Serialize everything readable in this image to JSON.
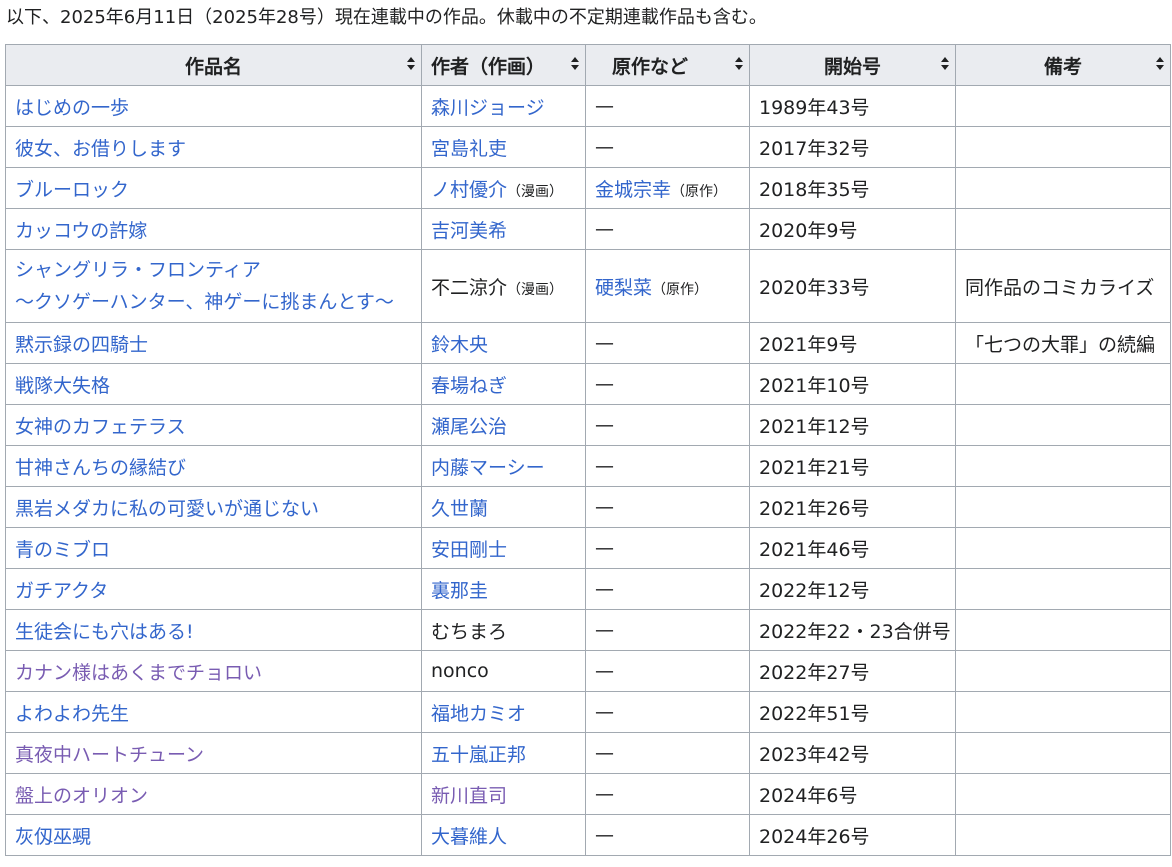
{
  "intro": "以下、2025年6月11日（2025年28号）現在連載中の作品。休載中の不定期連載作品も含む。",
  "headers": {
    "title": "作品名",
    "author": "作者（作画）",
    "original": "原作など",
    "start": "開始号",
    "notes": "備考"
  },
  "rows": [
    {
      "title": "はじめの一歩",
      "author": "森川ジョージ",
      "original": "—",
      "start": "1989年43号",
      "notes": ""
    },
    {
      "title": "彼女、お借りします",
      "author": "宮島礼吏",
      "original": "—",
      "start": "2017年32号",
      "notes": ""
    },
    {
      "title": "ブルーロック",
      "author": "ノ村優介",
      "author_note": "（漫画）",
      "original": "金城宗幸",
      "original_note": "（原作）",
      "start": "2018年35号",
      "notes": ""
    },
    {
      "title": "カッコウの許嫁",
      "author": "吉河美希",
      "original": "—",
      "start": "2020年9号",
      "notes": ""
    },
    {
      "title": "シャングリラ・フロンティア",
      "title2": "〜クソゲーハンター、神ゲーに挑まんとす〜",
      "author": "不二涼介",
      "author_note": "（漫画）",
      "original": "硬梨菜",
      "original_note": "（原作）",
      "start": "2020年33号",
      "notes": "同作品のコミカライズ"
    },
    {
      "title": "黙示録の四騎士",
      "author": "鈴木央",
      "original": "—",
      "start": "2021年9号",
      "notes": "「七つの大罪」の続編"
    },
    {
      "title": "戦隊大失格",
      "author": "春場ねぎ",
      "original": "—",
      "start": "2021年10号",
      "notes": ""
    },
    {
      "title": "女神のカフェテラス",
      "author": "瀬尾公治",
      "original": "—",
      "start": "2021年12号",
      "notes": ""
    },
    {
      "title": "甘神さんちの縁結び",
      "author": "内藤マーシー",
      "original": "—",
      "start": "2021年21号",
      "notes": ""
    },
    {
      "title": "黒岩メダカに私の可愛いが通じない",
      "author": "久世蘭",
      "original": "—",
      "start": "2021年26号",
      "notes": ""
    },
    {
      "title": "青のミブロ",
      "author": "安田剛士",
      "original": "—",
      "start": "2021年46号",
      "notes": ""
    },
    {
      "title": "ガチアクタ",
      "author": "裏那圭",
      "original": "—",
      "start": "2022年12号",
      "notes": ""
    },
    {
      "title": "生徒会にも穴はある!",
      "author": "むちまろ",
      "original": "—",
      "start": "2022年22・23合併号",
      "notes": ""
    },
    {
      "title": "カナン様はあくまでチョロい",
      "author": "nonco",
      "original": "—",
      "start": "2022年27号",
      "notes": ""
    },
    {
      "title": "よわよわ先生",
      "author": "福地カミオ",
      "original": "—",
      "start": "2022年51号",
      "notes": ""
    },
    {
      "title": "真夜中ハートチューン",
      "author": "五十嵐正邦",
      "original": "—",
      "start": "2023年42号",
      "notes": ""
    },
    {
      "title": "盤上のオリオン",
      "author": "新川直司",
      "original": "—",
      "start": "2024年6号",
      "notes": ""
    },
    {
      "title": "灰仭巫覡",
      "author": "大暮維人",
      "original": "—",
      "start": "2024年26号",
      "notes": ""
    }
  ],
  "colors": {
    "link": "#3366cc",
    "visited": "#795cb2",
    "header_bg": "#eaecf0",
    "border": "#a2a9b1"
  }
}
